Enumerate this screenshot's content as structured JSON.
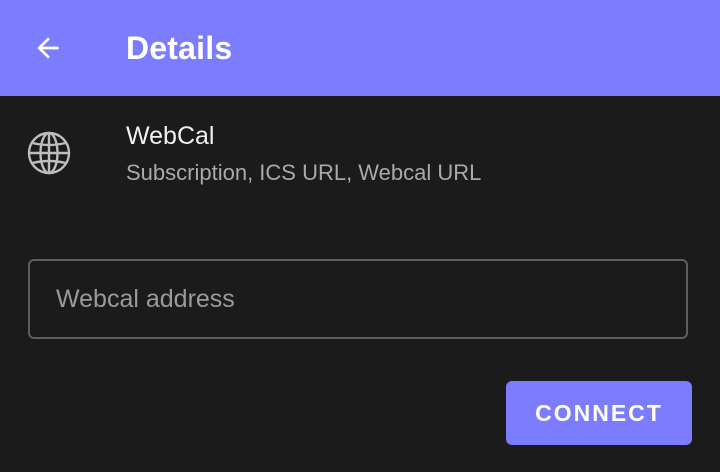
{
  "app_bar": {
    "title": "Details",
    "back_icon": "arrow-left-icon"
  },
  "service": {
    "icon": "globe-icon",
    "name": "WebCal",
    "description": "Subscription, ICS URL, Webcal URL"
  },
  "address_field": {
    "value": "",
    "placeholder": "Webcal address"
  },
  "connect_button": {
    "label": "CONNECT"
  },
  "colors": {
    "accent": "#7c7cff",
    "background": "#1b1b1b",
    "text_primary": "#f0f0f0",
    "text_secondary": "#a9a9a9",
    "border": "#5e5e5e"
  }
}
